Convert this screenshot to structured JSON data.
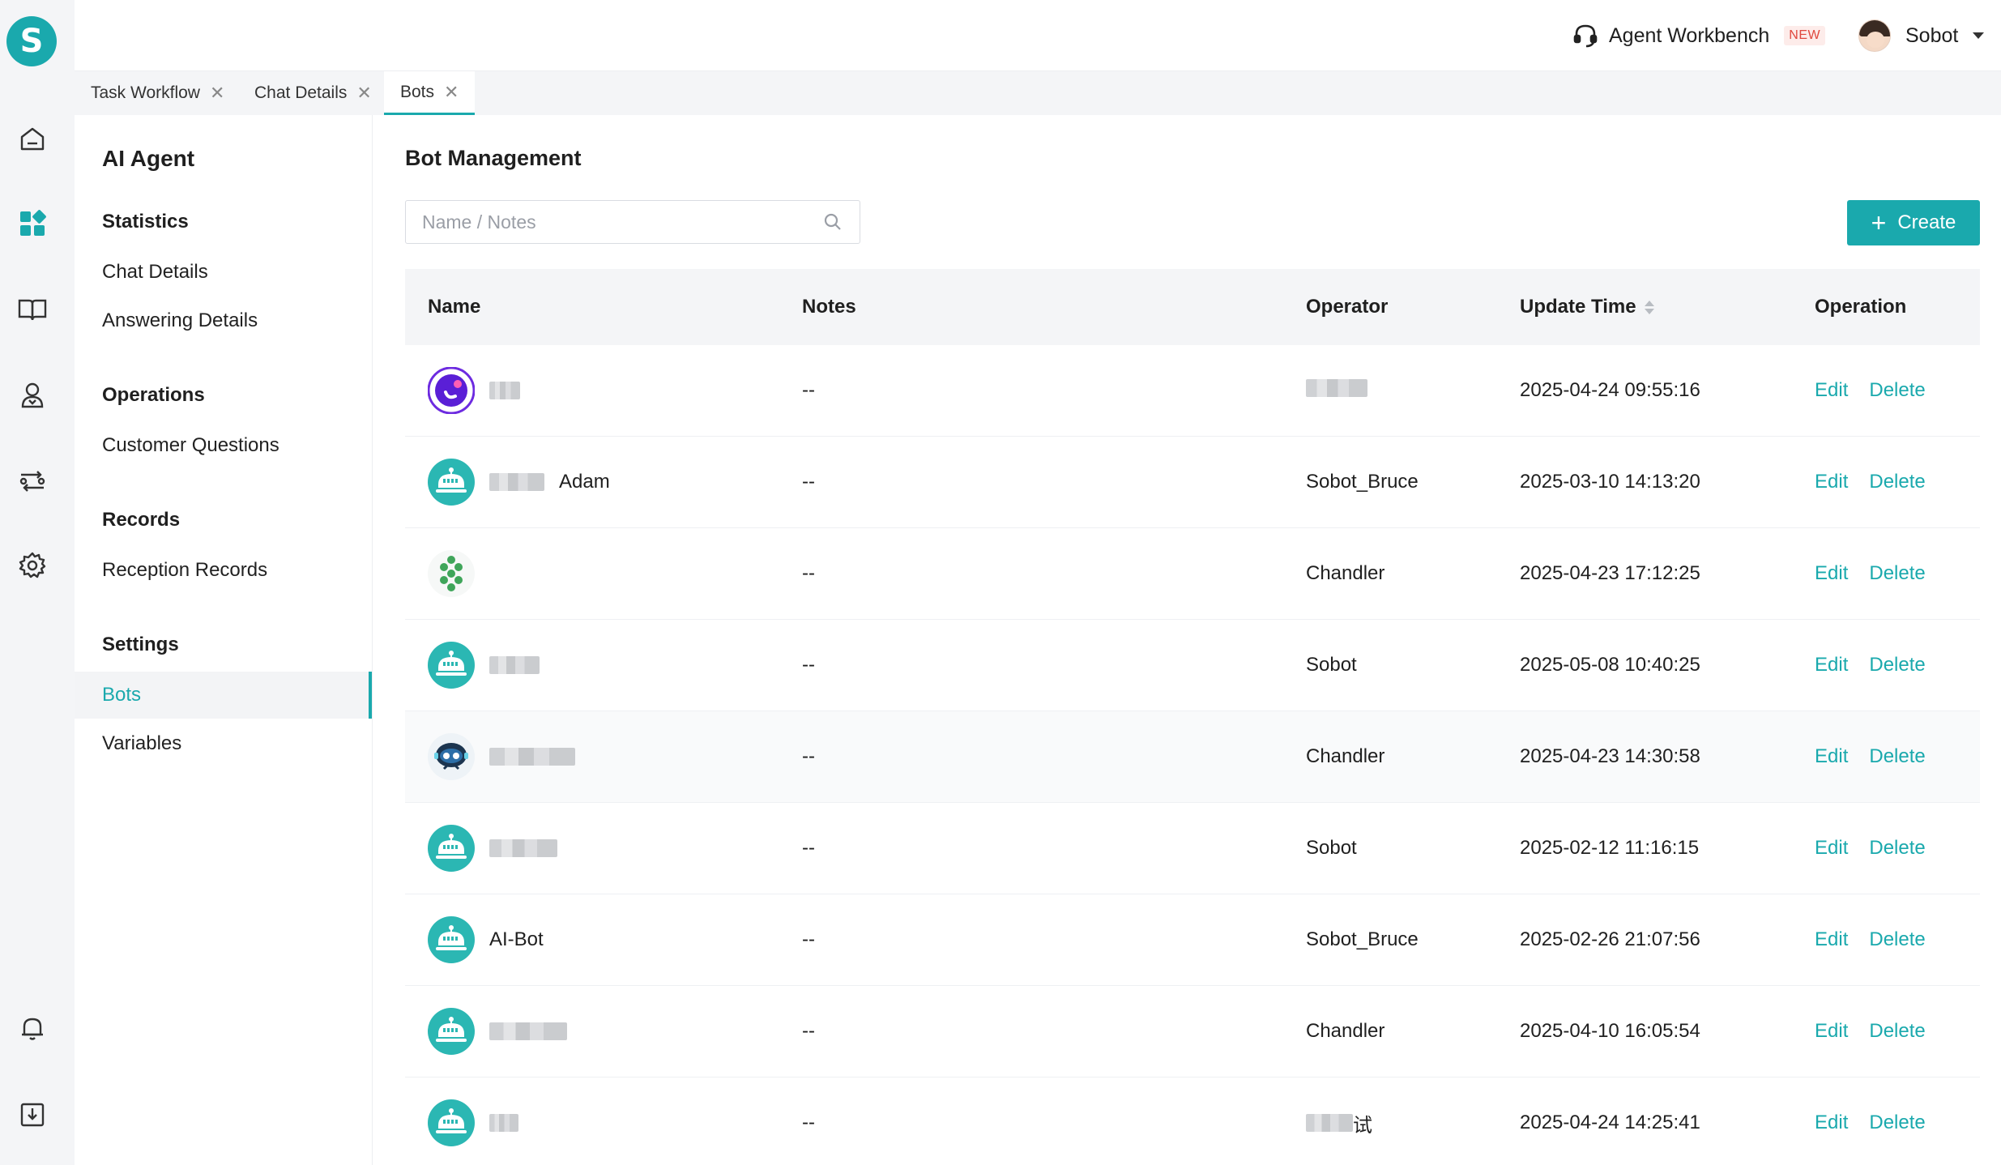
{
  "topbar": {
    "workbench_label": "Agent Workbench",
    "new_badge": "NEW",
    "user_name": "Sobot"
  },
  "logo_letter": "S",
  "tabs": [
    {
      "label": "Task Workflow"
    },
    {
      "label": "Chat Details"
    },
    {
      "label": "Bots"
    }
  ],
  "sidenav": {
    "title": "AI Agent",
    "sections": [
      {
        "label": "Statistics",
        "items": [
          "Chat Details",
          "Answering Details"
        ]
      },
      {
        "label": "Operations",
        "items": [
          "Customer Questions"
        ]
      },
      {
        "label": "Records",
        "items": [
          "Reception Records"
        ]
      },
      {
        "label": "Settings",
        "items": [
          "Bots",
          "Variables"
        ]
      }
    ],
    "active_item": "Bots"
  },
  "main": {
    "title": "Bot Management",
    "search_placeholder": "Name / Notes",
    "create_label": "Create",
    "columns": {
      "name": "Name",
      "notes": "Notes",
      "operator": "Operator",
      "update_time": "Update Time",
      "operation": "Operation"
    },
    "edit_label": "Edit",
    "delete_label": "Delete",
    "rows": [
      {
        "name": "",
        "notes": "--",
        "operator": "",
        "time": "2025-04-24 09:55:16",
        "avatar": "ring"
      },
      {
        "name": "Adam",
        "notes": "--",
        "operator": "Sobot_Bruce",
        "time": "2025-03-10 14:13:20",
        "avatar": "bot"
      },
      {
        "name": "",
        "notes": "--",
        "operator": "Chandler",
        "time": "2025-04-23 17:12:25",
        "avatar": "leaf"
      },
      {
        "name": "",
        "notes": "--",
        "operator": "Sobot",
        "time": "2025-05-08 10:40:25",
        "avatar": "bot"
      },
      {
        "name": "",
        "notes": "--",
        "operator": "Chandler",
        "time": "2025-04-23 14:30:58",
        "avatar": "robot-face"
      },
      {
        "name": "",
        "notes": "--",
        "operator": "Sobot",
        "time": "2025-02-12 11:16:15",
        "avatar": "bot"
      },
      {
        "name": "AI-Bot",
        "notes": "--",
        "operator": "Sobot_Bruce",
        "time": "2025-02-26 21:07:56",
        "avatar": "bot"
      },
      {
        "name": "",
        "notes": "--",
        "operator": "Chandler",
        "time": "2025-04-10 16:05:54",
        "avatar": "bot"
      },
      {
        "name": "",
        "notes": "--",
        "operator": "试",
        "time": "2025-04-24 14:25:41",
        "avatar": "bot"
      }
    ]
  },
  "colors": {
    "accent": "#1aa9ad",
    "header_bg": "#f4f5f7",
    "new_badge": "#e0483e"
  }
}
